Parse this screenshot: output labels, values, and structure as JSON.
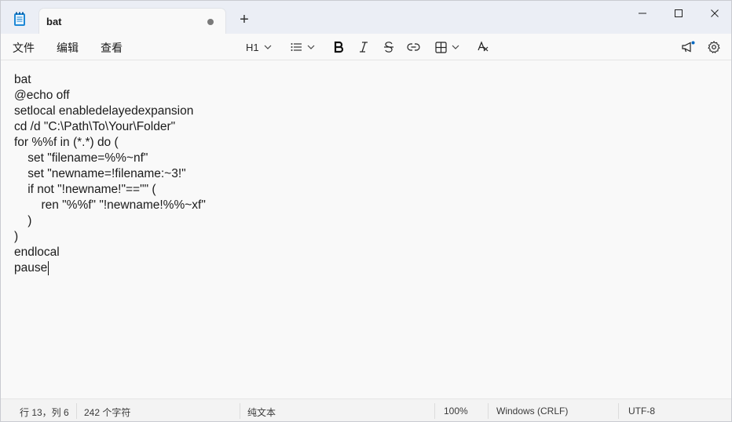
{
  "tab": {
    "title": "bat"
  },
  "new_tab_label": "+",
  "menu": {
    "file": "文件",
    "edit": "编辑",
    "view": "查看"
  },
  "toolbar": {
    "heading_label": "H1",
    "icons": [
      "list-icon",
      "bold-icon",
      "italic-icon",
      "strikethrough-icon",
      "link-icon",
      "table-icon",
      "clear-format-icon",
      "announcement-icon",
      "settings-icon"
    ]
  },
  "editor": {
    "lines": [
      "bat",
      "@echo off",
      "setlocal enabledelayedexpansion",
      "cd /d \"C:\\Path\\To\\Your\\Folder\"",
      "for %%f in (*.*) do (",
      "    set \"filename=%%~nf\"",
      "    set \"newname=!filename:~3!\"",
      "    if not \"!newname!\"==\"\" (",
      "        ren \"%%f\" \"!newname!%%~xf\"",
      "    )",
      ")",
      "endlocal",
      "pause"
    ]
  },
  "status": {
    "position": "行 13，列 6",
    "chars": "242 个字符",
    "format": "纯文本",
    "zoom": "100%",
    "line_ending": "Windows (CRLF)",
    "encoding": "UTF-8"
  },
  "colors": {
    "accent": "#0067c0",
    "title_bg": "#ebeef5",
    "editor_bg": "#f9f9f9"
  }
}
